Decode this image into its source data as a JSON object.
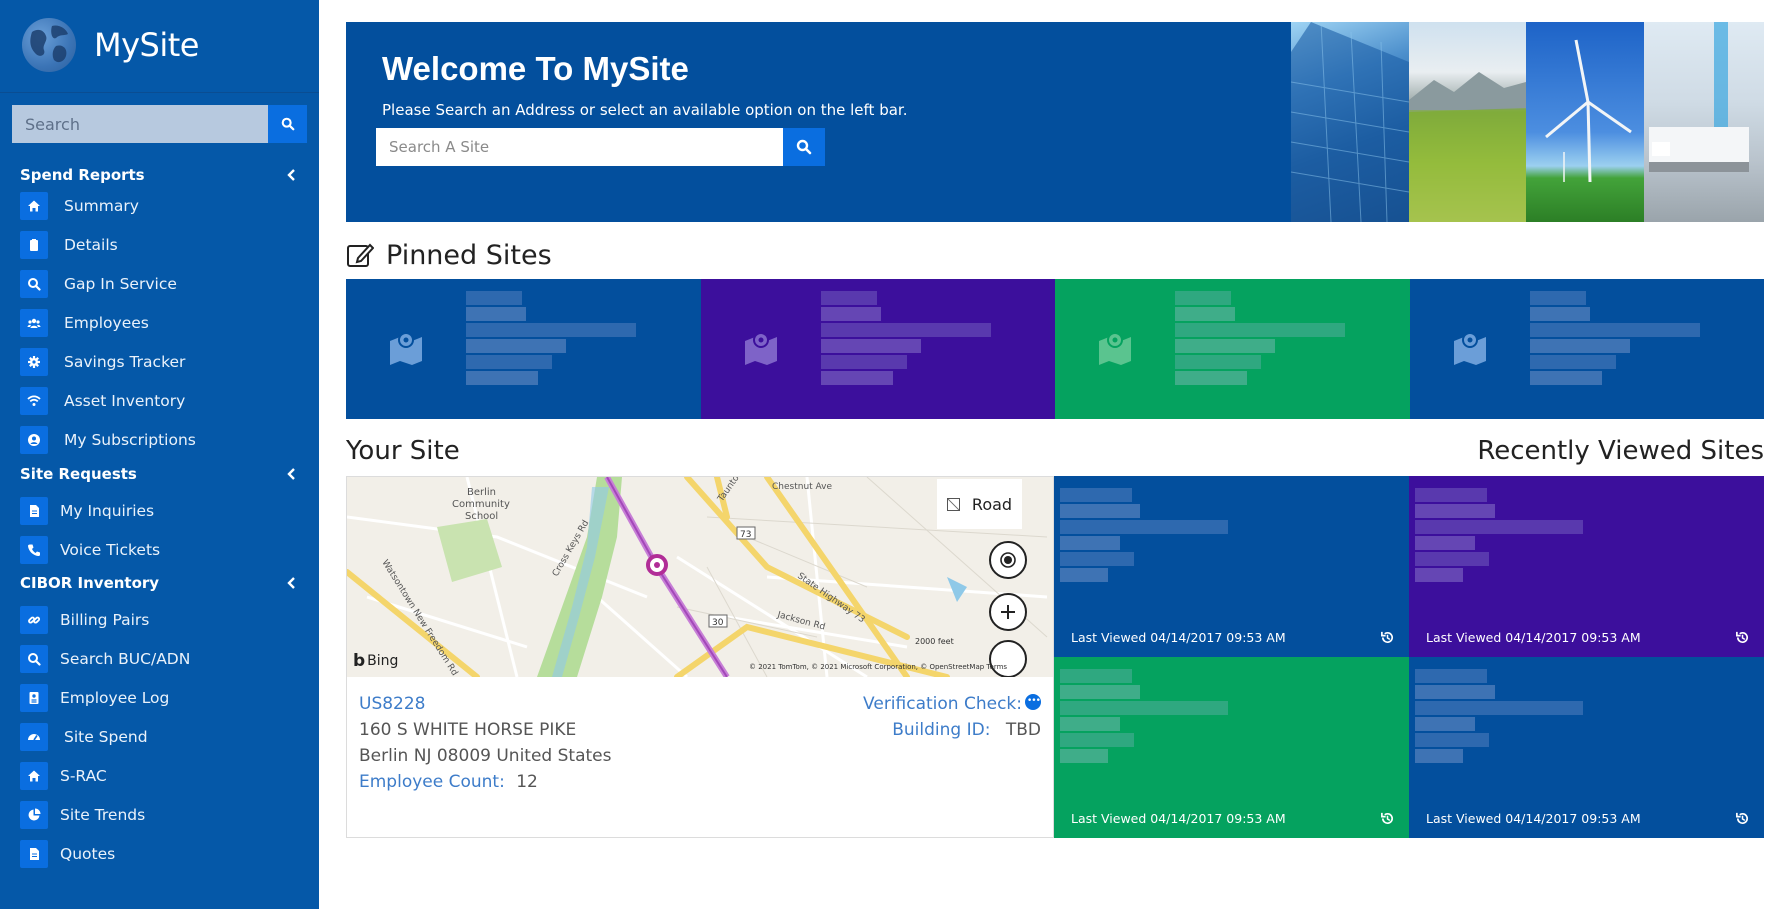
{
  "app": {
    "name": "MySite"
  },
  "sidebar": {
    "search_placeholder": "Search",
    "sections": [
      {
        "title": "Spend Reports",
        "items": [
          {
            "label": "Summary",
            "icon": "home-icon"
          },
          {
            "label": "Details",
            "icon": "clipboard-icon"
          },
          {
            "label": "Gap In Service",
            "icon": "search-icon"
          },
          {
            "label": "Employees",
            "icon": "users-icon"
          },
          {
            "label": "Savings Tracker",
            "icon": "gear-icon"
          },
          {
            "label": "Asset Inventory",
            "icon": "wifi-icon"
          },
          {
            "label": "My Subscriptions",
            "icon": "user-circle-icon"
          }
        ]
      },
      {
        "title": "Site Requests",
        "items": [
          {
            "label": "My Inquiries",
            "icon": "document-icon"
          },
          {
            "label": "Voice Tickets",
            "icon": "phone-icon"
          }
        ]
      },
      {
        "title": "CIBOR Inventory",
        "items": [
          {
            "label": "Billing Pairs",
            "icon": "link-icon"
          },
          {
            "label": "Search BUC/ADN",
            "icon": "search-icon"
          },
          {
            "label": "Employee Log",
            "icon": "id-card-icon"
          },
          {
            "label": "Site Spend",
            "icon": "dashboard-icon"
          },
          {
            "label": "S-RAC",
            "icon": "home-icon"
          },
          {
            "label": "Site Trends",
            "icon": "pie-chart-icon"
          },
          {
            "label": "Quotes",
            "icon": "document-icon"
          }
        ]
      }
    ]
  },
  "hero": {
    "title": "Welcome To MySite",
    "subtitle": "Please Search an Address or select an available option on the left bar.",
    "search_placeholder": "Search A Site"
  },
  "pinned": {
    "title": "Pinned Sites",
    "tiles": [
      {
        "color": "#034f9d"
      },
      {
        "color": "#3c0f9c"
      },
      {
        "color": "#05a25f"
      },
      {
        "color": "#034f9d"
      }
    ]
  },
  "your_site": {
    "title": "Your Site",
    "map": {
      "layer_button": "Road",
      "provider": "Bing",
      "copyright": "© 2021 TomTom, © 2021 Microsoft Corporation, © OpenStreetMap Terms",
      "scale": "2000 feet",
      "labels": [
        "Berlin Community School",
        "Cross Keys Rd",
        "Chestnut Ave",
        "Taunton",
        "73",
        "State Highway 73",
        "Jackson Rd",
        "Watsontown New Freedom Rd",
        "30"
      ]
    },
    "site_id": "US8228",
    "address_line1": "160 S WHITE HORSE PIKE",
    "address_line2": "Berlin NJ 08009 United States",
    "employee_count_label": "Employee Count:",
    "employee_count": "12",
    "verification_label": "Verification Check:",
    "building_id_label": "Building ID:",
    "building_id": "TBD"
  },
  "recent": {
    "title": "Recently Viewed Sites",
    "tiles": [
      {
        "color": "#034f9d",
        "last_viewed": "Last Viewed 04/14/2017 09:53 AM"
      },
      {
        "color": "#3c0f9c",
        "last_viewed": "Last Viewed 04/14/2017 09:53 AM"
      },
      {
        "color": "#05a25f",
        "last_viewed": "Last Viewed 04/14/2017 09:53 AM"
      },
      {
        "color": "#034f9d",
        "last_viewed": "Last Viewed 04/14/2017 09:53 AM"
      }
    ]
  }
}
